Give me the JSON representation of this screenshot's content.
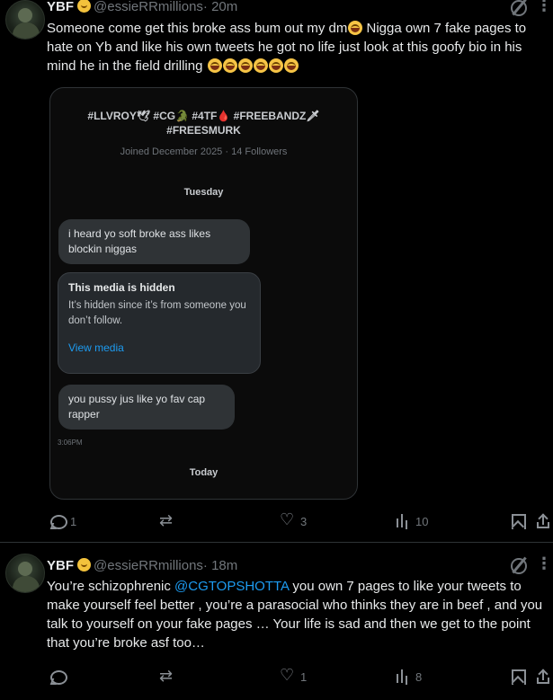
{
  "tweets": [
    {
      "name": "YBF",
      "handle": "@essieRRmillions",
      "time": "· 20m",
      "text_a": "Someone come get this broke ass bum out my dm",
      "text_b": " Nigga own 7 fake pages to hate on Yb and like his own tweets he got no life just look at this goofy bio in his mind he in the field drilling",
      "actions": {
        "replies": "1",
        "reposts": "",
        "likes": "3",
        "views": "10"
      }
    },
    {
      "name": "YBF",
      "handle": "@essieRRmillions",
      "time": "· 18m",
      "text_a": "You’re schizophrenic ",
      "mention": "@CGTOPSHOTTA",
      "text_b": " you own 7 pages to like your tweets to make yourself feel better , you’re a parasocial who thinks they are in beef , and you talk to yourself on your fake pages … Your life is sad and then we get to the point that you’re broke asf too…",
      "actions": {
        "replies": "",
        "reposts": "",
        "likes": "1",
        "views": "8"
      }
    }
  ],
  "card": {
    "cut_line": "",
    "bio_line1": "#LLVROY🕊 #CG🐊 #4TF🩸 #FREEBANDZ🗡",
    "bio_line2": "#FREESMURK",
    "joined": "Joined December 2025 · 14 Followers",
    "day1": "Tuesday",
    "msg1": "i heard yo soft broke ass likes blockin niggas",
    "hidden_title": "This media is hidden",
    "hidden_desc": "It’s hidden since it’s from someone you don’t follow.",
    "view_media": "View media",
    "msg2": "you pussy jus like yo fav cap rapper",
    "msg_time": "3:06PM",
    "day2": "Today"
  },
  "icons": [
    "reply-icon",
    "repost-icon",
    "like-icon",
    "views-icon",
    "bookmark-icon",
    "share-icon",
    "grok-icon",
    "more-icon",
    "verified-badge-icon",
    "laughing-emoji-icon"
  ]
}
